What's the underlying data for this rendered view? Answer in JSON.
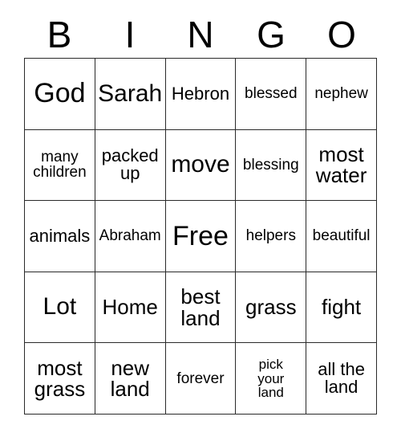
{
  "card": {
    "header_letters": [
      "B",
      "I",
      "N",
      "G",
      "O"
    ],
    "rows": [
      [
        {
          "text": "God",
          "size": "fs-xl"
        },
        {
          "text": "Sarah",
          "size": "fs-lg"
        },
        {
          "text": "Hebron",
          "size": "fs-sm"
        },
        {
          "text": "blessed",
          "size": "fs-xs"
        },
        {
          "text": "nephew",
          "size": "fs-xs"
        }
      ],
      [
        {
          "text": "many\nchildren",
          "size": "fs-xs"
        },
        {
          "text": "packed\nup",
          "size": "fs-sm"
        },
        {
          "text": "move",
          "size": "fs-lg"
        },
        {
          "text": "blessing",
          "size": "fs-xs"
        },
        {
          "text": "most\nwater",
          "size": "fs-md"
        }
      ],
      [
        {
          "text": "animals",
          "size": "fs-sm"
        },
        {
          "text": "Abraham",
          "size": "fs-xs"
        },
        {
          "text": "Free",
          "size": "fs-xl"
        },
        {
          "text": "helpers",
          "size": "fs-xs"
        },
        {
          "text": "beautiful",
          "size": "fs-xs"
        }
      ],
      [
        {
          "text": "Lot",
          "size": "fs-lg"
        },
        {
          "text": "Home",
          "size": "fs-md"
        },
        {
          "text": "best\nland",
          "size": "fs-md"
        },
        {
          "text": "grass",
          "size": "fs-md"
        },
        {
          "text": "fight",
          "size": "fs-md"
        }
      ],
      [
        {
          "text": "most\ngrass",
          "size": "fs-md"
        },
        {
          "text": "new\nland",
          "size": "fs-md"
        },
        {
          "text": "forever",
          "size": "fs-xs"
        },
        {
          "text": "pick\nyour\nland",
          "size": "fs-xxs"
        },
        {
          "text": "all the\nland",
          "size": "fs-sm"
        }
      ]
    ]
  }
}
